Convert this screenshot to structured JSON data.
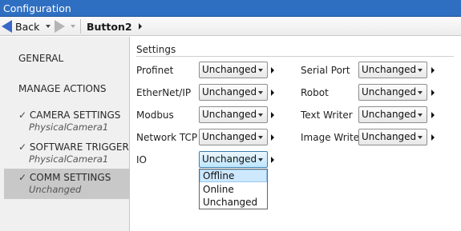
{
  "window": {
    "title": "Configuration"
  },
  "nav": {
    "back_label": "Back",
    "breadcrumb": "Button2"
  },
  "sidebar": {
    "items": [
      {
        "label": "GENERAL"
      },
      {
        "label": "MANAGE ACTIONS"
      },
      {
        "check": "✓",
        "label": "CAMERA SETTINGS",
        "sub": "PhysicalCamera1"
      },
      {
        "check": "✓",
        "label": "SOFTWARE TRIGGER",
        "sub": "PhysicalCamera1"
      },
      {
        "check": "✓",
        "label": "COMM SETTINGS",
        "sub": "Unchanged",
        "selected": true
      }
    ]
  },
  "settings": {
    "header": "Settings",
    "left": [
      {
        "label": "Profinet",
        "value": "Unchanged"
      },
      {
        "label": "EtherNet/IP",
        "value": "Unchanged"
      },
      {
        "label": "Modbus",
        "value": "Unchanged"
      },
      {
        "label": "Network TCP",
        "value": "Unchanged"
      },
      {
        "label": "IO",
        "value": "Unchanged"
      }
    ],
    "right": [
      {
        "label": "Serial Port",
        "value": "Unchanged"
      },
      {
        "label": "Robot",
        "value": "Unchanged"
      },
      {
        "label": "Text Writer",
        "value": "Unchanged"
      },
      {
        "label": "Image Writer",
        "value": "Unchanged"
      }
    ]
  },
  "io_dropdown": {
    "options": [
      "Offline",
      "Online",
      "Unchanged"
    ],
    "highlighted": "Offline"
  }
}
